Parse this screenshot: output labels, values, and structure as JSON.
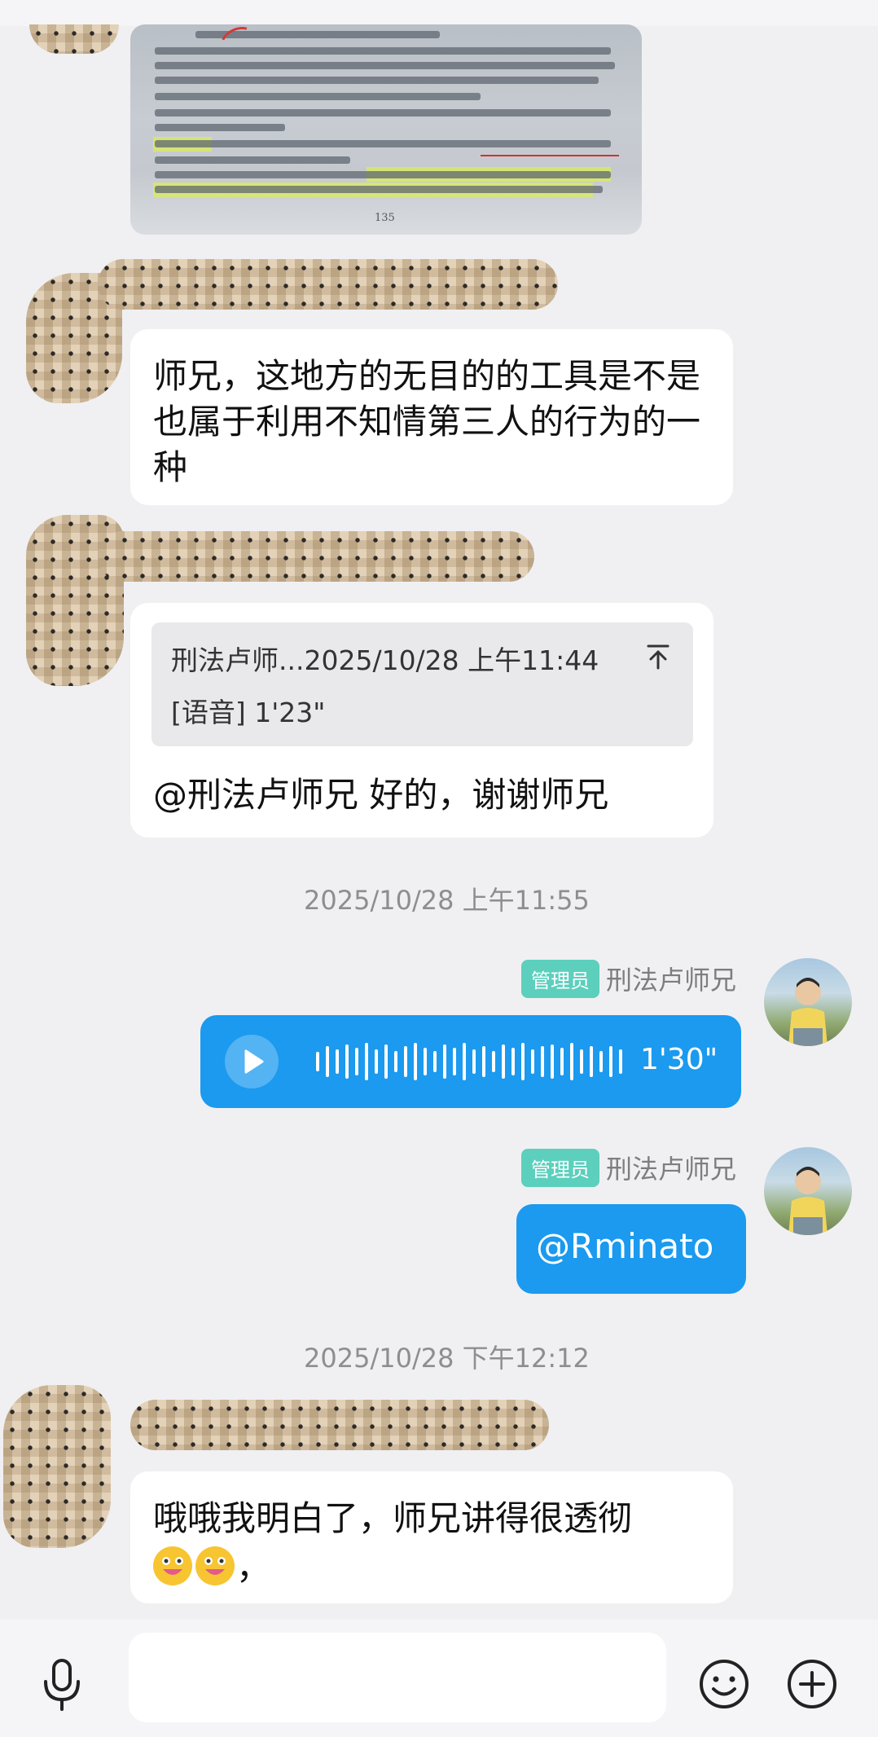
{
  "photo_message": {
    "page_number": "135",
    "lines": [
      "根据的“支配”，就只能是一种“控制”的支配力。",
      "所谓利用“无目的”的工具，如2025年真题案例一，按理说，具体实施绑架行为的是乙，而，甲应该",
      "构成绑架罪的教唆犯，但乙、丙并无勒索财物的目的，因此不可能构成绑架罪的实行犯，基于同样的理由，",
      "只能将甲认定为间接正犯的宝座，使其承担绑架罪间接正犯的责任。",
      "解析：例10，甲强迫乙自杀，甲构成故意杀人罪的间接正犯。",
      "例11（法考），甲明知前方有陷阱，故意害乙，欺骗乙开车前往，乙掉入陷阱死亡，甲构成故意杀人",
      "罪的间接正犯。",
      "答题提示：如果案例题涉及“片面共犯”的情形，建议作观点展示，不用具体展开写，给出肯定说和否",
      "定说的不同结论即可，会显高分答案。",
      "解析：以下各种处理方式总结起来就一句话：如果“过限结果”是各个行为人成立的那个共同犯罪的“法",
      "定加重结果”，其他行为人就需要对该过限结果负责，承担相应犯罪的结果加重犯的责任。"
    ]
  },
  "messages": {
    "m1_text": "师兄，这地方的无目的的工具是不是也属于利用不知情第三人的行为的一种",
    "m2_quote_header": "刑法卢师...2025/10/28 上午11:44",
    "m2_quote_body": "[语音] 1'23\"",
    "m2_text": "@刑法卢师兄 好的，谢谢师兄",
    "ts1": "2025/10/28 上午11:55",
    "admin_badge": "管理员",
    "admin_name": "刑法卢师兄",
    "voice_duration": "1'30\"",
    "m4_text": "@Rminato",
    "ts2": "2025/10/28 下午12:12",
    "m5_text": "哦哦我明白了，师兄讲得很透彻",
    "m5_tail": "，"
  },
  "icons": {
    "voice": "microphone-icon",
    "emoji": "smile-icon",
    "plus": "plus-circle-icon",
    "quote_jump": "arrow-up-to-top-icon"
  },
  "colors": {
    "accent": "#1b9aef",
    "admin_badge": "#5ccfbd",
    "background": "#f0f0f2"
  }
}
